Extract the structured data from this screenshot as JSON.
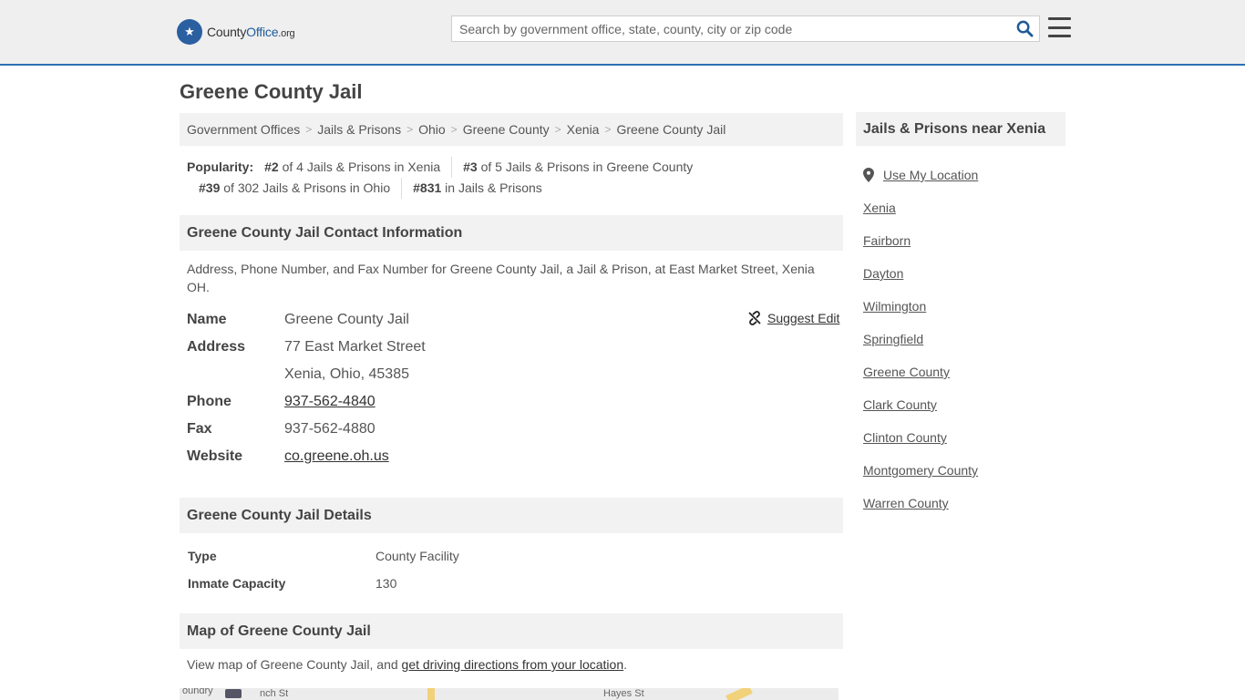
{
  "header": {
    "logo_pre": "County",
    "logo_bold": "Office",
    "logo_org": ".org",
    "search_placeholder": "Search by government office, state, county, city or zip code"
  },
  "page_title": "Greene County Jail",
  "breadcrumb": [
    "Government Offices",
    "Jails & Prisons",
    "Ohio",
    "Greene County",
    "Xenia",
    "Greene County Jail"
  ],
  "popularity": {
    "label": "Popularity:",
    "items": [
      {
        "rank": "#2",
        "text": " of 4 Jails & Prisons in Xenia"
      },
      {
        "rank": "#3",
        "text": " of 5 Jails & Prisons in Greene County"
      },
      {
        "rank": "#39",
        "text": " of 302 Jails & Prisons in Ohio"
      },
      {
        "rank": "#831",
        "text": " in Jails & Prisons"
      }
    ]
  },
  "contact": {
    "heading": "Greene County Jail Contact Information",
    "description": "Address, Phone Number, and Fax Number for Greene County Jail, a Jail & Prison, at East Market Street, Xenia OH.",
    "suggest_edit": "Suggest Edit",
    "name_label": "Name",
    "name": "Greene County Jail",
    "address_label": "Address",
    "address1": "77 East Market Street",
    "address2": "Xenia, Ohio, 45385",
    "phone_label": "Phone",
    "phone": "937-562-4840",
    "fax_label": "Fax",
    "fax": "937-562-4880",
    "website_label": "Website",
    "website": "co.greene.oh.us"
  },
  "details": {
    "heading": "Greene County Jail Details",
    "type_label": "Type",
    "type": "County Facility",
    "capacity_label": "Inmate Capacity",
    "capacity": "130"
  },
  "map": {
    "heading": "Map of Greene County Jail",
    "desc_pre": "View map of Greene County Jail, and ",
    "desc_link": "get driving directions from your location",
    "desc_post": ".",
    "labels": [
      "oundry",
      "nch St",
      "Hayes St"
    ]
  },
  "sidebar": {
    "heading": "Jails & Prisons near Xenia",
    "use_location": "Use My Location",
    "links": [
      "Xenia",
      "Fairborn",
      "Dayton",
      "Wilmington",
      "Springfield",
      "Greene County",
      "Clark County",
      "Clinton County",
      "Montgomery County",
      "Warren County"
    ]
  }
}
